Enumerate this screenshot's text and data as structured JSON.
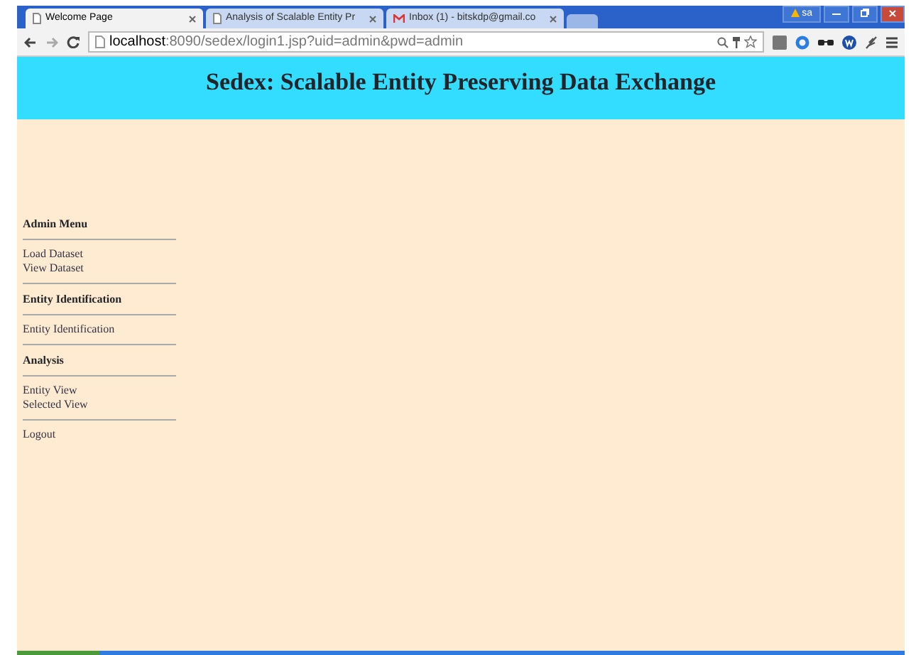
{
  "browser": {
    "tabs": [
      {
        "title": "Welcome Page",
        "selected": true
      },
      {
        "title": "Analysis of Scalable Entity Pr",
        "selected": false
      },
      {
        "title": "Inbox (1) - bitskdp@gmail.co",
        "selected": false
      }
    ],
    "user_badge": "sa",
    "url_host": "localhost",
    "url_path": ":8090/sedex/login1.jsp?uid=admin&pwd=admin"
  },
  "header": {
    "title": "Sedex: Scalable Entity Preserving Data Exchange"
  },
  "sidebar": {
    "sections": [
      {
        "heading": "Admin Menu",
        "links": [
          "Load Dataset",
          "View Dataset"
        ]
      },
      {
        "heading": "Entity Identification",
        "links": [
          "Entity Identification"
        ]
      },
      {
        "heading": "Analysis",
        "links": [
          "Entity View",
          "Selected View"
        ]
      },
      {
        "links": [
          "Logout"
        ]
      }
    ]
  }
}
